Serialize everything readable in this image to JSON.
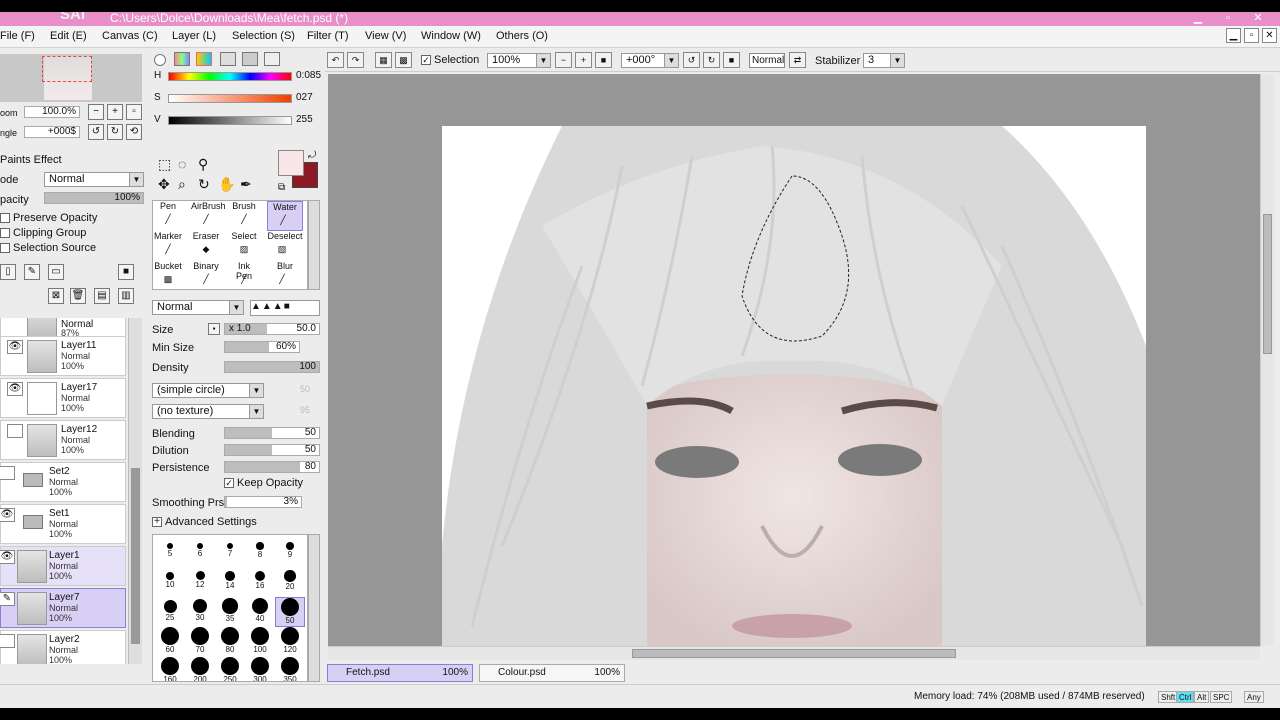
{
  "window": {
    "app_logo": "SAI",
    "title_path": "C:\\Users\\Dolce\\Downloads\\Mea\\fetch.psd (*)"
  },
  "menu": [
    {
      "label": "File (F)"
    },
    {
      "label": "Edit (E)"
    },
    {
      "label": "Canvas (C)"
    },
    {
      "label": "Layer (L)"
    },
    {
      "label": "Selection (S)"
    },
    {
      "label": "Filter (T)"
    },
    {
      "label": "View (V)"
    },
    {
      "label": "Window (W)"
    },
    {
      "label": "Others (O)"
    }
  ],
  "navigator": {
    "zoom_label": "oom",
    "zoom_value": "100.0%",
    "angle_label": "ngle",
    "angle_value": "+000$"
  },
  "layer_props": {
    "paints_effect": "Paints Effect",
    "mode_label": "ode",
    "mode_value": "Normal",
    "opacity_label": "pacity",
    "opacity_value": "100%",
    "opacity_level": 1.0,
    "preserve_opacity": "Preserve Opacity",
    "clipping_group": "Clipping Group",
    "selection_source": "Selection Source"
  },
  "layers": [
    {
      "name": "",
      "mode": "Normal",
      "opacity": "87%",
      "partial": true
    },
    {
      "name": "Layer11",
      "mode": "Normal",
      "opacity": "100%",
      "visible": true
    },
    {
      "name": "Layer17",
      "mode": "Normal",
      "opacity": "100%",
      "visible": true
    },
    {
      "name": "Layer12",
      "mode": "Normal",
      "opacity": "100%",
      "visible": false
    },
    {
      "name": "Set2",
      "mode": "Normal",
      "opacity": "100%",
      "folder": true
    },
    {
      "name": "Set1",
      "mode": "Normal",
      "opacity": "100%",
      "folder": true,
      "visible": true
    },
    {
      "name": "Layer1",
      "mode": "Normal",
      "opacity": "100%",
      "visible": true,
      "highlight": true
    },
    {
      "name": "Layer7",
      "mode": "Normal",
      "opacity": "100%",
      "active": true
    },
    {
      "name": "Layer2",
      "mode": "Normal",
      "opacity": "100%"
    }
  ],
  "color": {
    "h_label": "H",
    "h_value": "0:085",
    "h_level": 0.24,
    "s_label": "S",
    "s_value": "027",
    "s_level": 0.11,
    "v_label": "V",
    "v_value": "255",
    "v_level": 1.0,
    "primary": "#f8e6e8",
    "secondary": "#8b1a24"
  },
  "tools": [
    {
      "label": "Pen",
      "icon": "pen-icon"
    },
    {
      "label": "AirBrush",
      "icon": "airbrush-icon"
    },
    {
      "label": "Brush",
      "icon": "brush-icon"
    },
    {
      "label": "Water",
      "icon": "water-icon",
      "active": true
    },
    {
      "label": "Marker",
      "icon": "marker-icon"
    },
    {
      "label": "Eraser",
      "icon": "eraser-icon"
    },
    {
      "label": "Select",
      "icon": "select-icon"
    },
    {
      "label": "Deselect",
      "icon": "deselect-icon"
    },
    {
      "label": "Bucket",
      "icon": "bucket-icon"
    },
    {
      "label": "Binary",
      "icon": "binary-icon"
    },
    {
      "label": "Ink Pen",
      "icon": "inkpen-icon"
    },
    {
      "label": "Blur",
      "icon": "blur-icon"
    }
  ],
  "brush": {
    "blend_mode": "Normal",
    "size_label": "Size",
    "size_mult": "x 1.0",
    "size_value": "50.0",
    "min_size_label": "Min Size",
    "min_size_value": "60%",
    "density_label": "Density",
    "density_value": "100",
    "shape": "(simple circle)",
    "shape_value": "50",
    "texture": "(no texture)",
    "texture_value": "95",
    "blending_label": "Blending",
    "blending_value": "50",
    "dilution_label": "Dilution",
    "dilution_value": "50",
    "persistence_label": "Persistence",
    "persistence_value": "80",
    "keep_opacity": "Keep Opacity",
    "smoothing_label": "Smoothing Prs",
    "smoothing_value": "3%",
    "advanced": "Advanced Settings",
    "sizes": [
      "5",
      "6",
      "7",
      "8",
      "9",
      "10",
      "12",
      "14",
      "16",
      "20",
      "25",
      "30",
      "35",
      "40",
      "50",
      "60",
      "70",
      "80",
      "100",
      "120",
      "160",
      "200",
      "250",
      "300",
      "350"
    ],
    "selected_size": "50"
  },
  "canvas_toolbar": {
    "selection_label": "Selection",
    "zoom": "100%",
    "angle": "+000°",
    "blend": "Normal",
    "stabilizer_label": "Stabilizer",
    "stabilizer_value": "3"
  },
  "documents": [
    {
      "name": "Fetch.psd",
      "zoom": "100%",
      "active": true
    },
    {
      "name": "Colour.psd",
      "zoom": "100%",
      "active": false
    }
  ],
  "status": {
    "memory": "Memory load: 74% (208MB used / 874MB reserved)",
    "keys": [
      "Shft",
      "Ctrl",
      "Alt",
      "SPC",
      "Any"
    ]
  }
}
